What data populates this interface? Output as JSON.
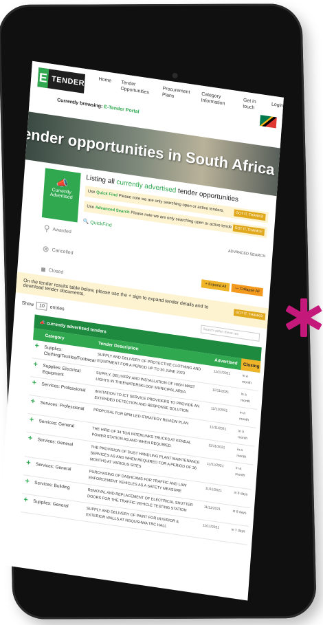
{
  "brand": {
    "logo_mark": "E",
    "logo_text": "TENDER"
  },
  "nav": [
    "Home",
    "Tender Opportunities",
    "Procurement Plans",
    "Category Information",
    "Get in touch",
    "Login"
  ],
  "browsing": {
    "label": "Currently browsing:",
    "portal": "E-Tender Portal"
  },
  "banner": {
    "title": "Tender opportunities in South Africa"
  },
  "sidebar": {
    "active": "Currently Advertised",
    "items": [
      "Awarded",
      "Cancelled",
      "Closed"
    ]
  },
  "listing": {
    "title_prefix": "Listing all ",
    "title_highlight": "currently advertised",
    "title_suffix": " tender opportunities",
    "hint1_prefix": "Use ",
    "hint1_link": "Quick Find",
    "hint1_text": " Please note we are only searching open or active tenders.",
    "hint2_prefix": "Use ",
    "hint2_link": "Advanced Search",
    "hint2_text": " Please note we are only searching open or active tende",
    "got_it": "GOT IT, THANKS!",
    "quickfind": "QuickFind",
    "advanced_search": "ADVANCED SEARCH",
    "expand_all": "+ Expand All",
    "collapse_all": "— Collapse All"
  },
  "notice": {
    "text": "On the tender results table below, please use the + sign to expand tender details and to download tender documents.",
    "got_it": "GOT IT, THANKS!"
  },
  "table_controls": {
    "show": "Show",
    "entries_value": "10",
    "entries": "entries",
    "search_placeholder": "Search within these res"
  },
  "table": {
    "title": "currently advertised tenders",
    "headers": [
      "Category",
      "Tender Description",
      "Advertised",
      "Closing"
    ],
    "rows": [
      {
        "category": "Supplies: Clothing/Textiles/Footwear",
        "description": "SUPPLY AND DELIVERY OF PROTECTIVE CLOTHING AND EQUIPMENT FOR A PERIOD UP TO 30 JUNE 2023",
        "advertised": "11/11/2021",
        "closing": "in a month"
      },
      {
        "category": "Supplies: Electrical Equipment",
        "description": "SUPPLY, DELIVERY AND INSTALLATION OF HIGH MAST LIGHTS IN THEEWATERSKLOOF MUNICIPAL AREA",
        "advertised": "11/11/2021",
        "closing": "in a month"
      },
      {
        "category": "Services: Professional",
        "description": "INVITATION TO ICT SERVICE PROVIDERS TO PROVIDE AN EXTENDED DETECTION AND RESPONSE SOLUTION",
        "advertised": "11/11/2021",
        "closing": "in a month"
      },
      {
        "category": "Services: Professional",
        "description": "Proposal for BPM LED Strategy Review plan",
        "advertised": "11/11/2021",
        "closing": "in a month"
      },
      {
        "category": "Services: General",
        "description": "The Hire of 34 Ton Interlinks Trucks at Kendal Power Station as and when required.",
        "advertised": "11/11/2021",
        "closing": "in a month"
      },
      {
        "category": "Services: General",
        "description": "THE PROVISION OF DUST HANDLING PLANT MAINTENANCE SERVICES AS AND WHEN REQUIRED FOR A PERIOD OF 36 MONTHS AT VARIOUS SITES",
        "advertised": "11/11/2021",
        "closing": "in a month"
      },
      {
        "category": "Services: General",
        "description": "PURCHASING OF DASHCAMS FOR TRAFFIC AND LAW ENFORCEMENT VEHICLES AS A SAFETY MEASURE",
        "advertised": "11/11/2021",
        "closing": "in 8 days"
      },
      {
        "category": "Services: Building",
        "description": "Removal and Replacement of Electrical shutter doors for the Traffic Vehicle Testing Station",
        "advertised": "11/11/2021",
        "closing": "in 8 days"
      },
      {
        "category": "Supplies: General",
        "description": "Supply and Delivery of Paint for Interior & Exterior Walls at Ngqushwa TRC Hall",
        "advertised": "11/11/2021",
        "closing": "in 7 days"
      }
    ]
  },
  "colors": {
    "brand_green": "#2fa84f",
    "accent_yellow": "#f0b429",
    "asterisk": "#c4187a"
  }
}
